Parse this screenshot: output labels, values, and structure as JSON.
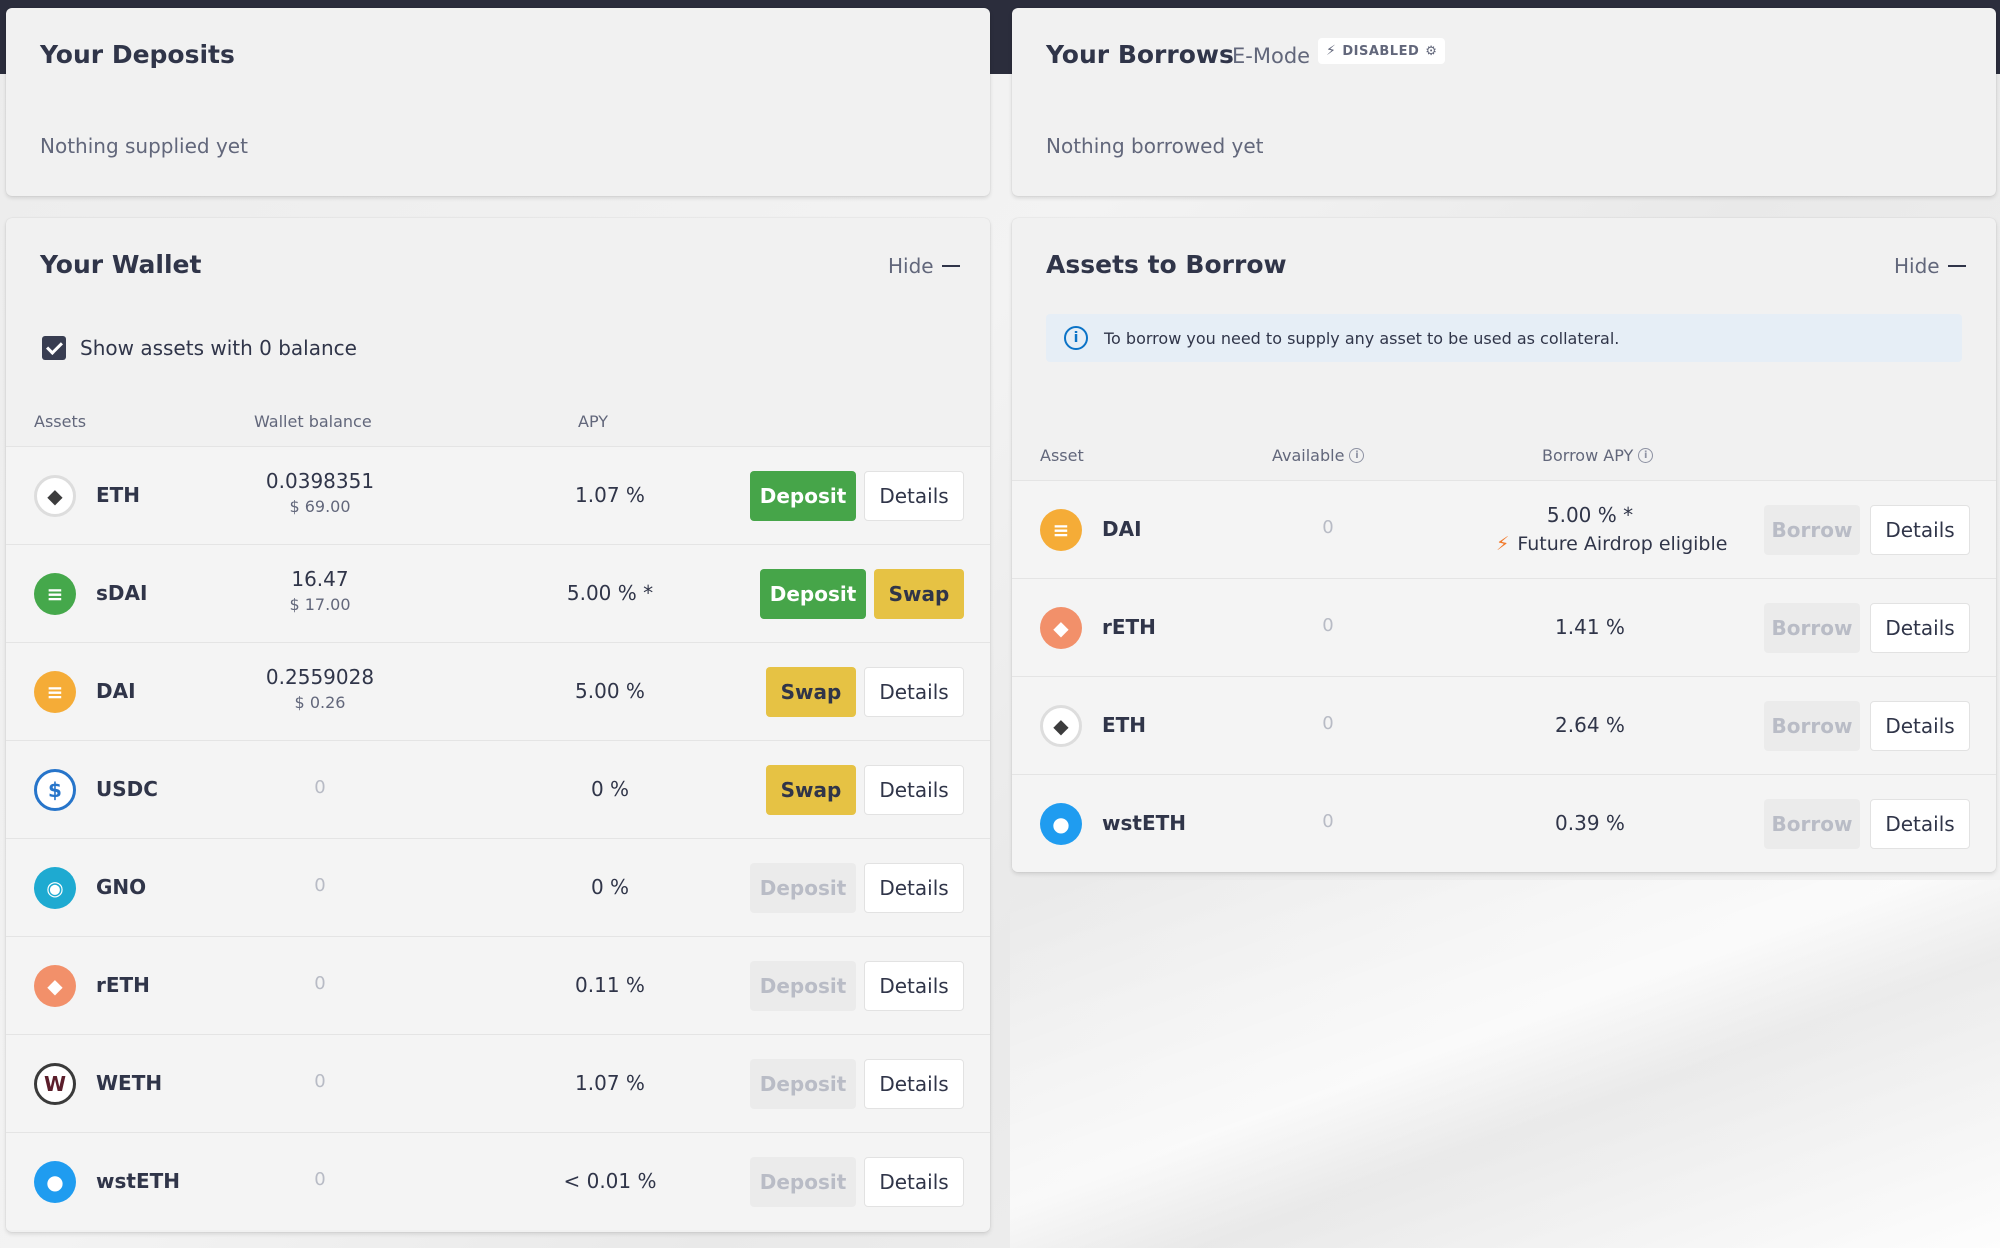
{
  "deposits": {
    "title": "Your Deposits",
    "empty": "Nothing supplied yet"
  },
  "borrows": {
    "title": "Your Borrows",
    "emode_label": "E-Mode",
    "emode_badge": "DISABLED",
    "empty": "Nothing borrowed yet"
  },
  "wallet": {
    "title": "Your Wallet",
    "hide_label": "Hide",
    "checkbox_label": "Show assets with 0 balance",
    "checkbox_checked": true,
    "columns": [
      "Assets",
      "Wallet balance",
      "APY"
    ],
    "rows": [
      {
        "asset": "ETH",
        "icon": "eth-icon",
        "balance": "0.0398351",
        "usd": "$ 69.00",
        "apy": "1.07 %",
        "buttons": [
          {
            "label": "Deposit",
            "style": "green"
          },
          {
            "label": "Details",
            "style": "white"
          }
        ]
      },
      {
        "asset": "sDAI",
        "icon": "sdai-icon",
        "balance": "16.47",
        "usd": "$ 17.00",
        "apy": "5.00 % *",
        "buttons": [
          {
            "label": "Deposit",
            "style": "green"
          },
          {
            "label": "Swap",
            "style": "yellow"
          }
        ]
      },
      {
        "asset": "DAI",
        "icon": "dai-icon",
        "balance": "0.2559028",
        "usd": "$ 0.26",
        "apy": "5.00 %",
        "buttons": [
          {
            "label": "Swap",
            "style": "yellow"
          },
          {
            "label": "Details",
            "style": "white"
          }
        ]
      },
      {
        "asset": "USDC",
        "icon": "usdc-icon",
        "balance": "0",
        "usd": "",
        "apy": "0 %",
        "buttons": [
          {
            "label": "Swap",
            "style": "yellow"
          },
          {
            "label": "Details",
            "style": "white"
          }
        ]
      },
      {
        "asset": "GNO",
        "icon": "gno-icon",
        "balance": "0",
        "usd": "",
        "apy": "0 %",
        "buttons": [
          {
            "label": "Deposit",
            "style": "disabled"
          },
          {
            "label": "Details",
            "style": "white"
          }
        ]
      },
      {
        "asset": "rETH",
        "icon": "reth-icon",
        "balance": "0",
        "usd": "",
        "apy": "0.11 %",
        "buttons": [
          {
            "label": "Deposit",
            "style": "disabled"
          },
          {
            "label": "Details",
            "style": "white"
          }
        ]
      },
      {
        "asset": "WETH",
        "icon": "weth-icon",
        "balance": "0",
        "usd": "",
        "apy": "1.07 %",
        "buttons": [
          {
            "label": "Deposit",
            "style": "disabled"
          },
          {
            "label": "Details",
            "style": "white"
          }
        ]
      },
      {
        "asset": "wstETH",
        "icon": "wsteth-icon",
        "balance": "0",
        "usd": "",
        "apy": "< 0.01 %",
        "buttons": [
          {
            "label": "Deposit",
            "style": "disabled"
          },
          {
            "label": "Details",
            "style": "white"
          }
        ]
      }
    ]
  },
  "borrow_assets": {
    "title": "Assets to Borrow",
    "hide_label": "Hide",
    "info": "To borrow you need to supply any asset to be used as collateral.",
    "columns": [
      "Asset",
      "Available",
      "Borrow APY"
    ],
    "rows": [
      {
        "asset": "DAI",
        "icon": "dai-icon",
        "available": "0",
        "apy": "5.00 % *",
        "note": "Future Airdrop eligible",
        "borrow_label": "Borrow",
        "details_label": "Details"
      },
      {
        "asset": "rETH",
        "icon": "reth-icon",
        "available": "0",
        "apy": "1.41 %",
        "note": "",
        "borrow_label": "Borrow",
        "details_label": "Details"
      },
      {
        "asset": "ETH",
        "icon": "eth-icon",
        "available": "0",
        "apy": "2.64 %",
        "note": "",
        "borrow_label": "Borrow",
        "details_label": "Details"
      },
      {
        "asset": "wstETH",
        "icon": "wsteth-icon",
        "available": "0",
        "apy": "0.39 %",
        "note": "",
        "borrow_label": "Borrow",
        "details_label": "Details"
      }
    ]
  },
  "colors": {
    "accent_green": "#46a549",
    "accent_yellow": "#e6c244",
    "topbar": "#2b2d3c",
    "info_blue": "#0b73c7"
  }
}
